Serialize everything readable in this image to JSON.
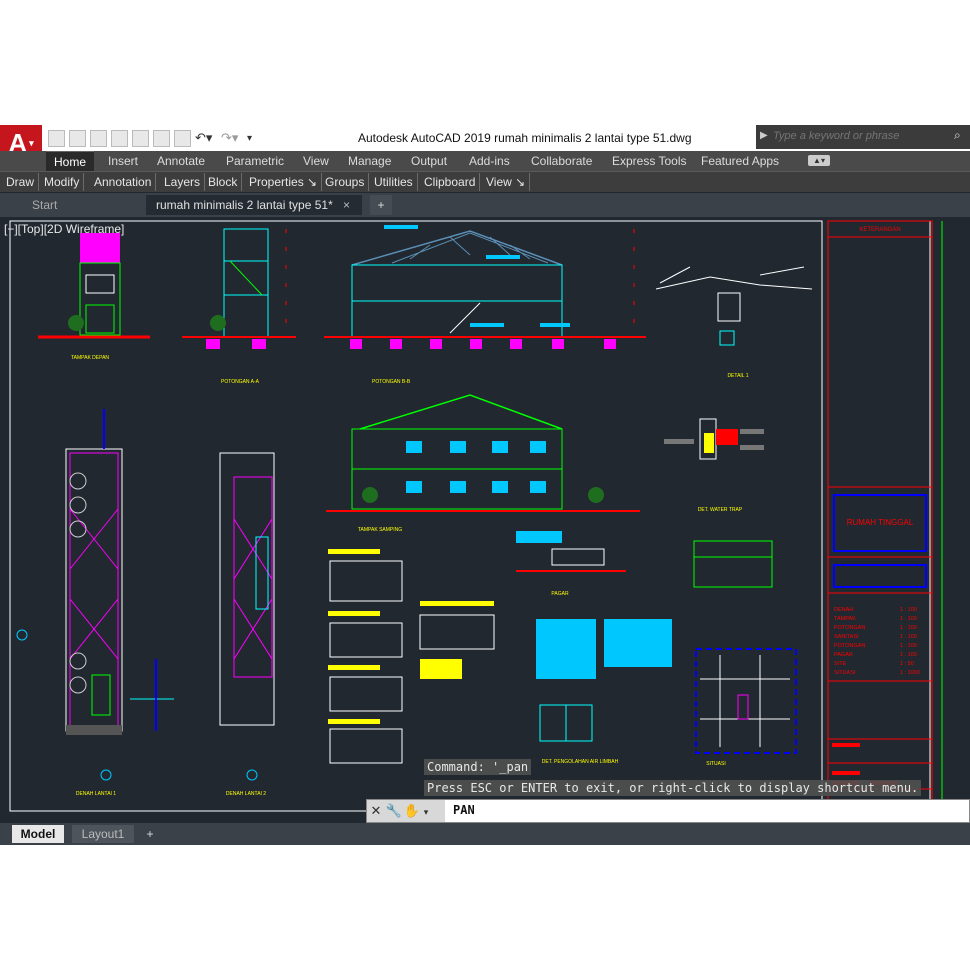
{
  "app": {
    "logo": "A",
    "title": "Autodesk AutoCAD 2019    rumah minimalis 2 lantai type 51.dwg",
    "search_placeholder": "Type a keyword or phrase"
  },
  "ribbon": {
    "tabs": [
      "Home",
      "Insert",
      "Annotate",
      "Parametric",
      "View",
      "Manage",
      "Output",
      "Add-ins",
      "Collaborate",
      "Express Tools",
      "Featured Apps"
    ],
    "panels": [
      "Draw",
      "Modify",
      "Annotation",
      "Layers",
      "Block",
      "Properties",
      "Groups",
      "Utilities",
      "Clipboard",
      "View"
    ]
  },
  "file_tabs": {
    "start": "Start",
    "drawing": "rumah minimalis 2 lantai type 51*",
    "close": "×",
    "new": "+"
  },
  "viewport": {
    "label": "[−][Top][2D Wireframe]",
    "sheet_labels": {
      "tampak_depan": "TAMPAK DEPAN",
      "potongan_aa": "POTONGAN A-A",
      "potongan_bb": "POTONGAN B-B",
      "detail_1": "DETAIL 1",
      "tampak_samping": "TAMPAK SAMPING",
      "detail_2": "DET. WATER TRAP",
      "denah_1": "DENAH LANTAI 1",
      "denah_2": "DENAH LANTAI 2",
      "pagar": "PAGAR",
      "septic": "DET. PENGOLAHAN AIR LIMBAH",
      "situasi": "SITUASI"
    },
    "title_block": {
      "header": "KETERANGAN",
      "project": "RUMAH TINGGAL",
      "sheet_list": [
        "DENAH",
        "TAMPAK",
        "POTONGAN",
        "SANITASI",
        "POTONGAN",
        "PAGAR",
        "SITE",
        "SITUASI"
      ],
      "scales": [
        "1 : 100",
        "1 : 100",
        "1 : 100",
        "1 : 100",
        "1 : 100",
        "1 : 100",
        "1 : 50",
        "1 : 1000"
      ]
    }
  },
  "command": {
    "history_1": "Command: '_pan",
    "history_2": "Press ESC or ENTER to exit, or right-click to display shortcut menu.",
    "input": "PAN"
  },
  "layout_tabs": {
    "model": "Model",
    "layout1": "Layout1",
    "new": "+"
  },
  "colors": {
    "viewport_bg": "#212830",
    "accent_red": "#ff0000",
    "cad_cyan": "#00c8ff",
    "cad_green": "#00ff00",
    "cad_magenta": "#ff00ff",
    "cad_yellow": "#ffff00"
  }
}
